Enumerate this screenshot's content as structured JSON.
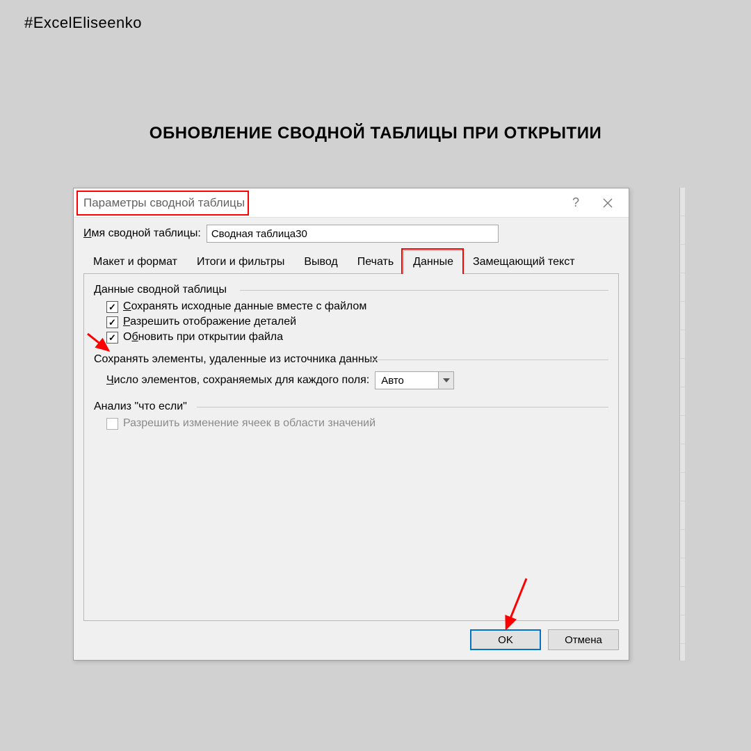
{
  "hashtag": "#ExcelEliseenko",
  "pageTitle": "ОБНОВЛЕНИЕ СВОДНОЙ ТАБЛИЦЫ ПРИ ОТКРЫТИИ",
  "dialog": {
    "title": "Параметры сводной таблицы",
    "helpSymbol": "?",
    "nameLabelPrefix": "Имя сводной таблицы:",
    "nameLabelUnderlineChar": "И",
    "nameValue": "Сводная таблица30",
    "tabs": [
      "Макет и формат",
      "Итоги и фильтры",
      "Вывод",
      "Печать",
      "Данные",
      "Замещающий текст"
    ],
    "activeTabIndex": 4,
    "group1Label": "Данные сводной таблицы",
    "checks": [
      {
        "label": "Сохранять исходные данные вместе с файлом",
        "checked": true,
        "uIndex": 0
      },
      {
        "label": "Разрешить отображение деталей",
        "checked": true,
        "uIndex": 0
      },
      {
        "label": "Обновить при открытии файла",
        "checked": true,
        "uIndex": 1
      }
    ],
    "group2Label": "Сохранять элементы, удаленные из источника данных",
    "retainLabel": "Число элементов, сохраняемых для каждого поля:",
    "retainUnderlineIndex": 0,
    "retainValue": "Авто",
    "group3Label": "Анализ \"что если\"",
    "disabledCheckLabel": "Разрешить изменение ячеек в области значений",
    "okLabel": "OK",
    "cancelLabel": "Отмена"
  }
}
